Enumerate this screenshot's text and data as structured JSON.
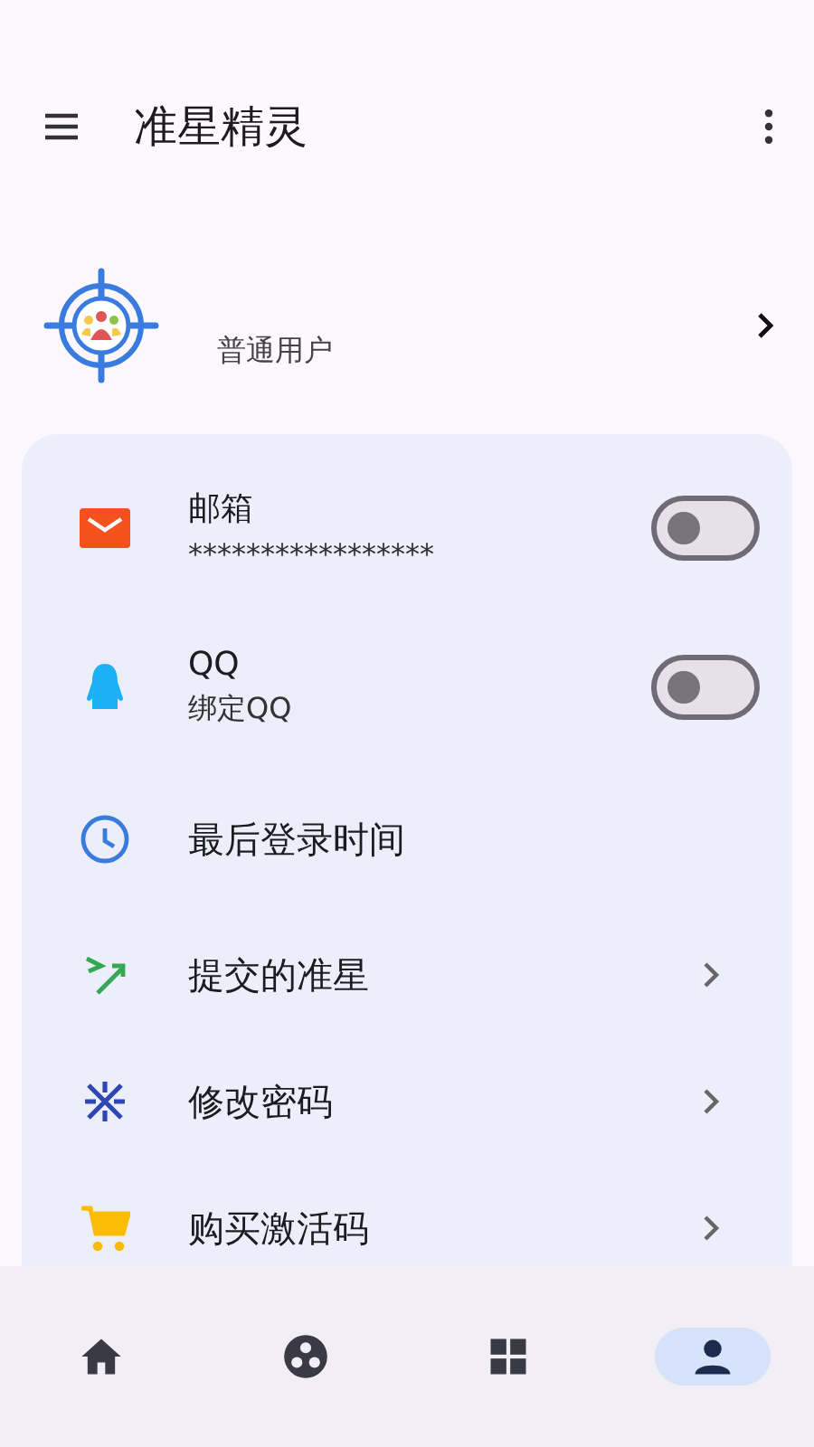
{
  "app_bar": {
    "title": "准星精灵"
  },
  "user": {
    "role": "普通用户"
  },
  "settings": [
    {
      "kind": "toggle",
      "title": "邮箱",
      "subtitle": "*****************",
      "on": false
    },
    {
      "kind": "toggle",
      "title": "QQ",
      "subtitle": "绑定QQ",
      "on": false
    },
    {
      "kind": "info",
      "title": "最后登录时间"
    },
    {
      "kind": "link",
      "title": "提交的准星"
    },
    {
      "kind": "link",
      "title": "修改密码"
    },
    {
      "kind": "link",
      "title": "购买激活码"
    }
  ],
  "bottom_nav": [
    {
      "selected": false
    },
    {
      "selected": false
    },
    {
      "selected": false
    },
    {
      "selected": true
    }
  ]
}
